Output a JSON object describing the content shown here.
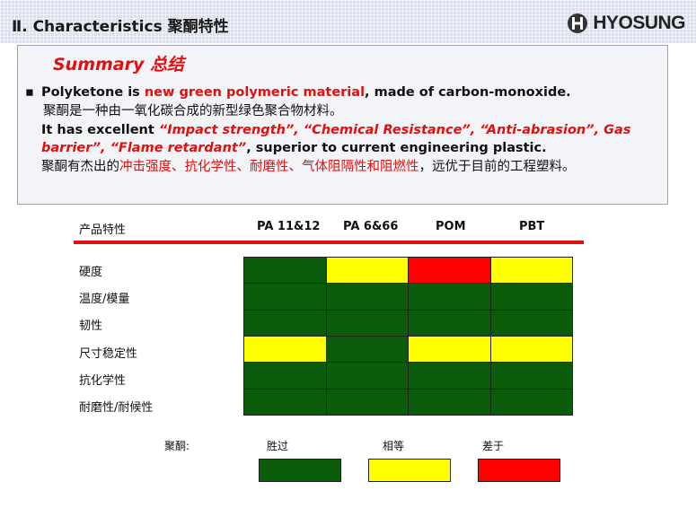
{
  "header": {
    "title": "Ⅱ. Characteristics 聚酮特性",
    "logo_text": "HYOSUNG"
  },
  "summary": {
    "title": "Summary 总结",
    "bullet": "▪",
    "p1_a": "Polyketone is ",
    "p1_red": "new green polymeric material",
    "p1_b": ", made of carbon-monoxide.",
    "p2": "聚酮是一种由一氧化碳合成的新型绿色聚合物材料。",
    "p3_a": "It has excellent ",
    "p3_red": "“Impact strength”, “Chemical Resistance”, “Anti-abrasion”, Gas barrier”, “Flame retardant”",
    "p3_b": ", superior to current engineering plastic.",
    "p4_a": "聚酮有杰出的",
    "p4_red": "冲击强度、抗化学性、耐磨性、气体阻隔性和阻燃性",
    "p4_b": "，远优于目前的工程塑料。"
  },
  "table": {
    "header_label": "产品特性",
    "columns": [
      "PA 11&12",
      "PA 6&66",
      "POM",
      "PBT"
    ],
    "rows": [
      {
        "label": "硬度",
        "values": [
          "win",
          "equal",
          "lose",
          "equal"
        ]
      },
      {
        "label": "温度/模量",
        "values": [
          "win",
          "win",
          "win",
          "win"
        ]
      },
      {
        "label": "韧性",
        "values": [
          "win",
          "win",
          "win",
          "win"
        ]
      },
      {
        "label": "尺寸稳定性",
        "values": [
          "equal",
          "win",
          "equal",
          "equal"
        ]
      },
      {
        "label": "抗化学性",
        "values": [
          "win",
          "win",
          "win",
          "win"
        ]
      },
      {
        "label": "耐磨性/耐候性",
        "values": [
          "win",
          "win",
          "win",
          "win"
        ]
      }
    ]
  },
  "legend": {
    "title": "聚酮:",
    "items": [
      {
        "label": "胜过",
        "key": "win"
      },
      {
        "label": "相等",
        "key": "equal"
      },
      {
        "label": "差于",
        "key": "lose"
      }
    ]
  },
  "colors": {
    "win": "#0a5c0a",
    "equal": "#ffff00",
    "lose": "#ff0000",
    "accent_red": "#e01010"
  }
}
